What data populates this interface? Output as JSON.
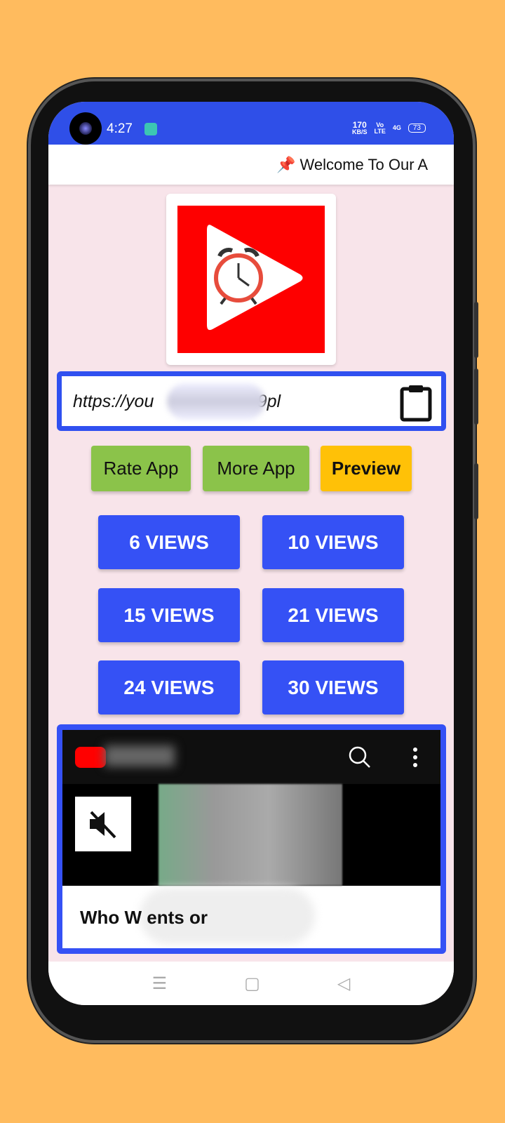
{
  "status": {
    "time": "4:27",
    "speed": "170",
    "speed_unit": "KB/S",
    "volte": "Vo",
    "lte": "LTE",
    "network": "4G",
    "battery": "73"
  },
  "marquee": {
    "icon": "pushpin-icon",
    "text": "📌 Welcome To Our A"
  },
  "url_input": {
    "value": "https://you                         r99pl"
  },
  "actions": {
    "rate": "Rate App",
    "more": "More App",
    "preview": "Preview"
  },
  "views": [
    "6 VIEWS",
    "10 VIEWS",
    "15 VIEWS",
    "21 VIEWS",
    "24 VIEWS",
    "30 VIEWS"
  ],
  "video": {
    "title": "Who W                               ents or"
  },
  "colors": {
    "accent": "#3551F5",
    "green": "#8BC34A",
    "amber": "#FFC107",
    "background": "#F8E4EA"
  }
}
